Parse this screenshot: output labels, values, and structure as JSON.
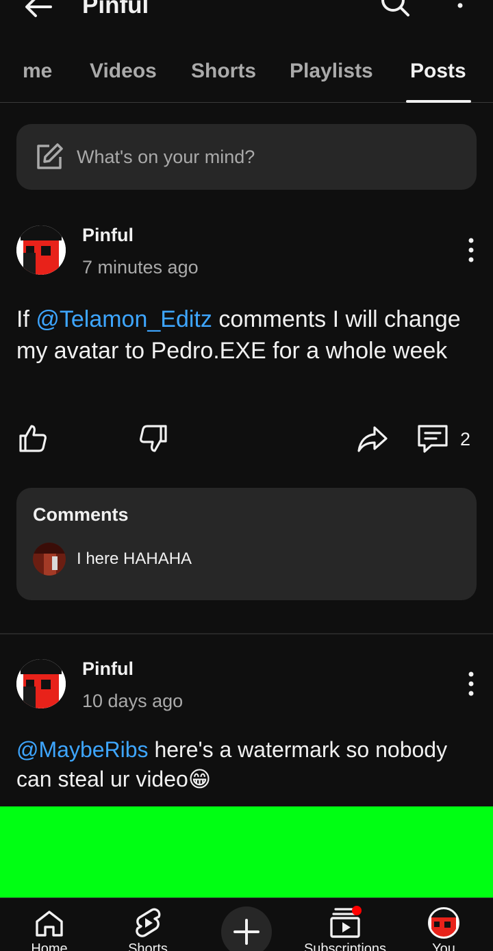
{
  "header": {
    "title": "Pinful",
    "back_icon": "arrow-left-icon",
    "search_icon": "search-icon",
    "menu_icon": "more-vert-icon"
  },
  "tabs": [
    {
      "label": "me",
      "active": false
    },
    {
      "label": "Videos",
      "active": false
    },
    {
      "label": "Shorts",
      "active": false
    },
    {
      "label": "Playlists",
      "active": false
    },
    {
      "label": "Posts",
      "active": true
    }
  ],
  "compose": {
    "placeholder": "What's on your mind?",
    "icon": "edit-icon"
  },
  "posts": [
    {
      "author": "Pinful",
      "time": "7 minutes ago",
      "text_prefix": "If ",
      "mention": "@Telamon_Editz",
      "text_suffix": " comments I will change my avatar to Pedro.EXE for a whole week",
      "comment_count": "2",
      "comments": {
        "title": "Comments",
        "preview_text": "I here HAHAHA"
      }
    },
    {
      "author": "Pinful",
      "time": "10 days ago",
      "mention": "@MaybeRibs",
      "text_suffix": " here's a watermark so nobody can steal ur video😁"
    }
  ],
  "bottom_nav": [
    {
      "label": "Home",
      "icon": "home-icon"
    },
    {
      "label": "Shorts",
      "icon": "shorts-icon"
    },
    {
      "label": "",
      "icon": "create-icon"
    },
    {
      "label": "Subscriptions",
      "icon": "subscriptions-icon"
    },
    {
      "label": "You",
      "icon": "avatar-icon"
    }
  ],
  "colors": {
    "background": "#0f0f0f",
    "surface": "#272727",
    "mention": "#3ea6ff",
    "image_green": "#00ff13",
    "badge_red": "#ff0000"
  }
}
